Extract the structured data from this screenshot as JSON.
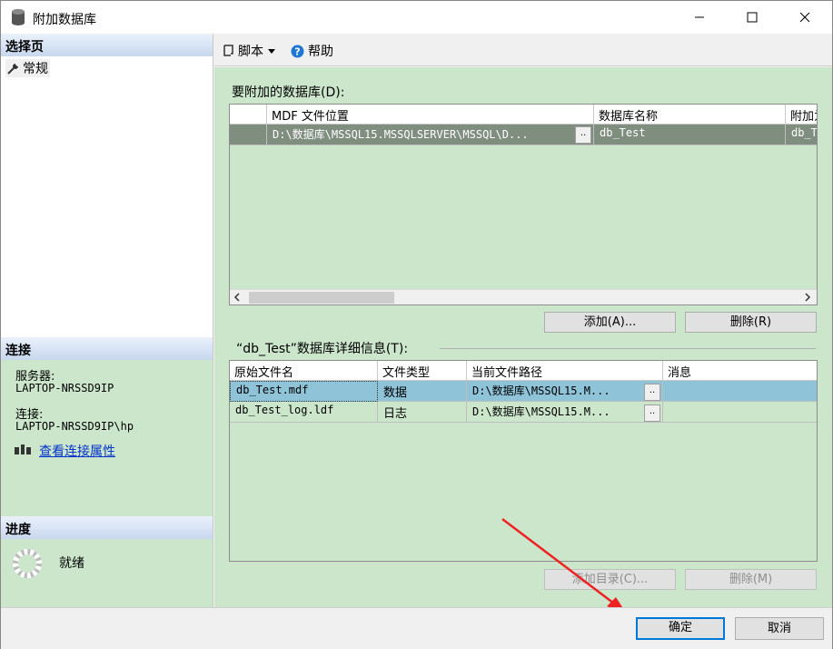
{
  "window": {
    "title": "附加数据库"
  },
  "left": {
    "select_page_header": "选择页",
    "nav_general": "常规",
    "connection_header": "连接",
    "server_label": "服务器:",
    "server_value": "LAPTOP-NRSSD9IP",
    "connection_label": "连接:",
    "connection_value": "LAPTOP-NRSSD9IP\\hp",
    "view_connection_properties": "查看连接属性",
    "progress_header": "进度",
    "progress_status": "就绪"
  },
  "toolbar": {
    "script_label": "脚本",
    "help_label": "帮助"
  },
  "attach_section": {
    "label": "要附加的数据库(D):",
    "columns": [
      "MDF 文件位置",
      "数据库名称",
      "附加为"
    ],
    "rows": [
      {
        "mdf_location": "D:\\数据库\\MSSQL15.MSSQLSERVER\\MSSQL\\D...",
        "db_name": "db_Test",
        "attach_as": "db_Test"
      }
    ],
    "add_button": "添加(A)...",
    "remove_button": "删除(R)"
  },
  "details_section": {
    "label": "“db_Test”数据库详细信息(T):",
    "columns": [
      "原始文件名",
      "文件类型",
      "当前文件路径",
      "消息"
    ],
    "rows": [
      {
        "file_name": "db_Test.mdf",
        "file_type": "数据",
        "path": "D:\\数据库\\MSSQL15.M...",
        "message": ""
      },
      {
        "file_name": "db_Test_log.ldf",
        "file_type": "日志",
        "path": "D:\\数据库\\MSSQL15.M...",
        "message": ""
      }
    ],
    "add_catalog_button": "添加目录(C)...",
    "remove_button": "删除(M)"
  },
  "footer": {
    "ok_button": "确定",
    "cancel_button": "取消"
  },
  "colors": {
    "panel_green": "#cce6cc",
    "selected_row": "#8ec3d8",
    "gray_row": "#808e80"
  }
}
